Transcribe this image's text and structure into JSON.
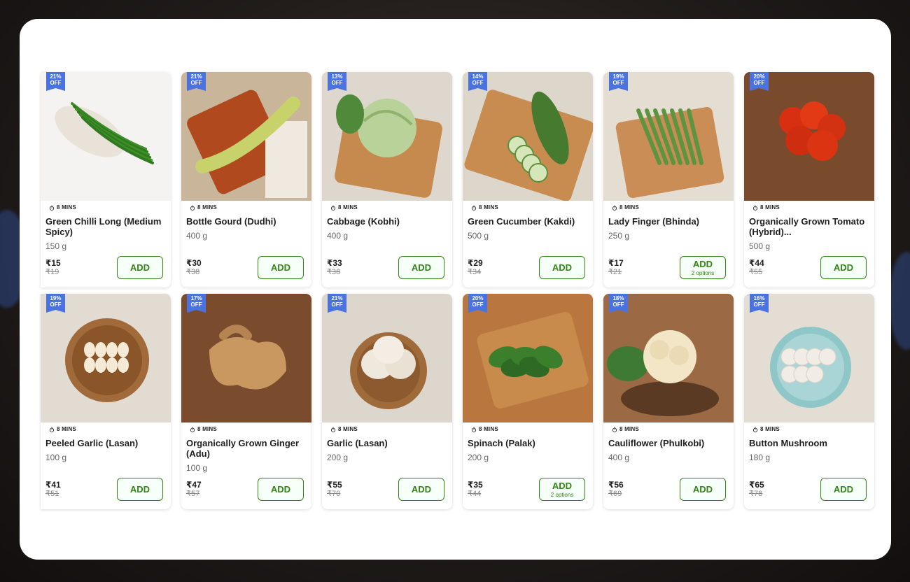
{
  "products": [
    {
      "discount": "21%\nOFF",
      "eta": "8 MINS",
      "name": "Green Chilli Long (Medium Spicy)",
      "qty": "150 g",
      "price": "₹15",
      "mrp": "₹19",
      "button": "ADD",
      "options": "",
      "bg": "#f4f3f1",
      "item": "chilli"
    },
    {
      "discount": "21%\nOFF",
      "eta": "8 MINS",
      "name": "Bottle Gourd (Dudhi)",
      "qty": "400 g",
      "price": "₹30",
      "mrp": "₹38",
      "button": "ADD",
      "options": "",
      "bg": "#c9b59a",
      "item": "gourd"
    },
    {
      "discount": "13%\nOFF",
      "eta": "8 MINS",
      "name": "Cabbage (Kobhi)",
      "qty": "400 g",
      "price": "₹33",
      "mrp": "₹38",
      "button": "ADD",
      "options": "",
      "bg": "#ddd7cd",
      "item": "cabbage"
    },
    {
      "discount": "14%\nOFF",
      "eta": "8 MINS",
      "name": "Green Cucumber (Kakdi)",
      "qty": "500 g",
      "price": "₹29",
      "mrp": "₹34",
      "button": "ADD",
      "options": "",
      "bg": "#ddd6cb",
      "item": "cucumber"
    },
    {
      "discount": "19%\nOFF",
      "eta": "8 MINS",
      "name": "Lady Finger (Bhinda)",
      "qty": "250 g",
      "price": "₹17",
      "mrp": "₹21",
      "button": "ADD",
      "options": "2 options",
      "bg": "#e4ddd2",
      "item": "okra"
    },
    {
      "discount": "20%\nOFF",
      "eta": "8 MINS",
      "name": "Organically Grown Tomato (Hybrid)...",
      "qty": "500 g",
      "price": "₹44",
      "mrp": "₹55",
      "button": "ADD",
      "options": "",
      "bg": "#7a4a2c",
      "item": "tomato"
    },
    {
      "discount": "19%\nOFF",
      "eta": "8 MINS",
      "name": "Peeled Garlic (Lasan)",
      "qty": "100 g",
      "price": "₹41",
      "mrp": "₹51",
      "button": "ADD",
      "options": "",
      "bg": "#e2dbd1",
      "item": "peeled"
    },
    {
      "discount": "17%\nOFF",
      "eta": "8 MINS",
      "name": "Organically Grown Ginger (Adu)",
      "qty": "100 g",
      "price": "₹47",
      "mrp": "₹57",
      "button": "ADD",
      "options": "",
      "bg": "#7b4b2e",
      "item": "ginger"
    },
    {
      "discount": "21%\nOFF",
      "eta": "8 MINS",
      "name": "Garlic (Lasan)",
      "qty": "200 g",
      "price": "₹55",
      "mrp": "₹70",
      "button": "ADD",
      "options": "",
      "bg": "#ddd6cc",
      "item": "garlic"
    },
    {
      "discount": "20%\nOFF",
      "eta": "8 MINS",
      "name": "Spinach (Palak)",
      "qty": "200 g",
      "price": "₹35",
      "mrp": "₹44",
      "button": "ADD",
      "options": "2 options",
      "bg": "#b9773f",
      "item": "spinach"
    },
    {
      "discount": "18%\nOFF",
      "eta": "8 MINS",
      "name": "Cauliflower (Phulkobi)",
      "qty": "400 g",
      "price": "₹56",
      "mrp": "₹69",
      "button": "ADD",
      "options": "",
      "bg": "#9b6a44",
      "item": "cauliflower"
    },
    {
      "discount": "16%\nOFF",
      "eta": "8 MINS",
      "name": "Button Mushroom",
      "qty": "180 g",
      "price": "₹65",
      "mrp": "₹78",
      "button": "ADD",
      "options": "",
      "bg": "#e3ddd3",
      "item": "mushroom"
    }
  ],
  "colors": {
    "accent": "#318616",
    "badge": "#4b73e0",
    "modal": "#ffffff"
  }
}
